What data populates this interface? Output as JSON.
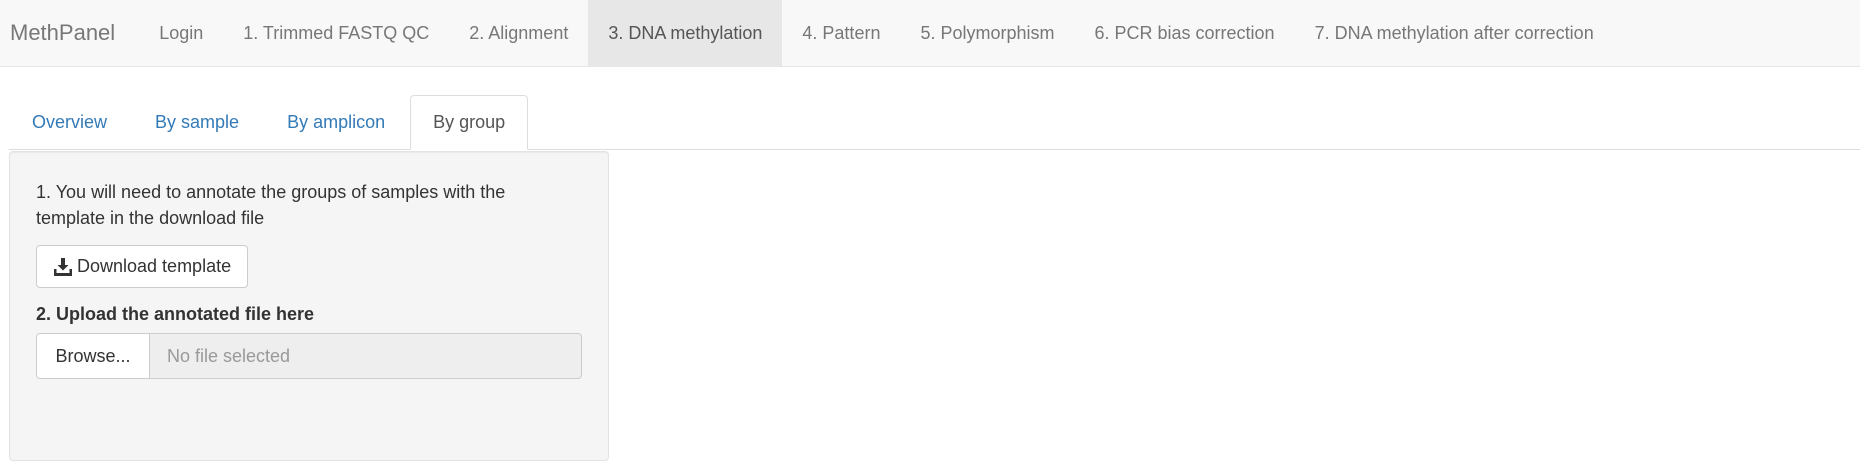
{
  "navbar": {
    "brand": "MethPanel",
    "items": [
      {
        "label": "Login"
      },
      {
        "label": "1. Trimmed FASTQ QC"
      },
      {
        "label": "2. Alignment"
      },
      {
        "label": "3. DNA methylation"
      },
      {
        "label": "4. Pattern"
      },
      {
        "label": "5. Polymorphism"
      },
      {
        "label": "6. PCR bias correction"
      },
      {
        "label": "7. DNA methylation after correction"
      }
    ],
    "active_index": 3
  },
  "subtabs": {
    "items": [
      {
        "label": "Overview"
      },
      {
        "label": "By sample"
      },
      {
        "label": "By amplicon"
      },
      {
        "label": "By group"
      }
    ],
    "active_index": 3
  },
  "panel": {
    "instruction": "1. You will need to annotate the groups of samples with the template in the download file",
    "download_label": "Download template",
    "download_icon": "download-icon",
    "upload_label": "2. Upload the annotated file here",
    "browse_label": "Browse...",
    "file_placeholder": "No file selected"
  },
  "colors": {
    "link": "#337ab7",
    "navbar_bg": "#f8f8f8",
    "navbar_active_bg": "#e7e7e7",
    "well_bg": "#f5f5f5"
  }
}
